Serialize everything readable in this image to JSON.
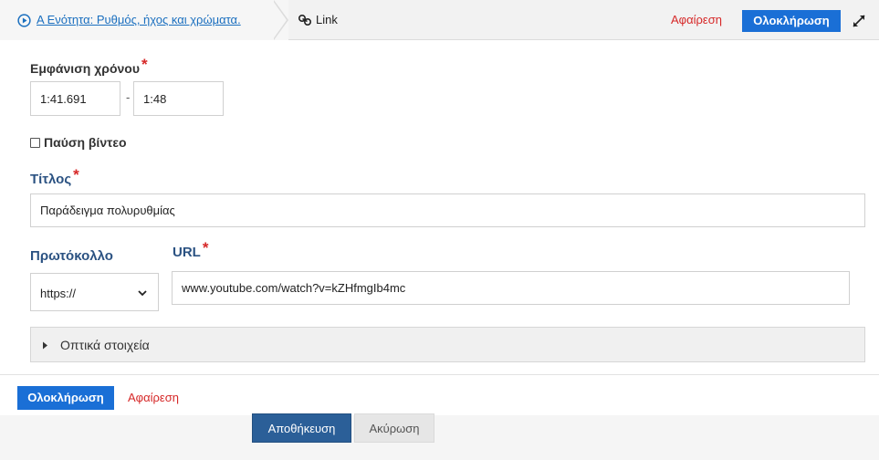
{
  "topbar": {
    "breadcrumb_link": "Α Ενότητα: Ρυθμός, ήχος και χρώματα.",
    "current_label": "Link",
    "remove_label": "Αφαίρεση",
    "done_label": "Ολοκλήρωση",
    "icons": [
      "play-circle-icon",
      "link-icon",
      "expand-icon"
    ]
  },
  "form": {
    "time_label": "Εμφάνιση χρόνου",
    "time_start": "1:41.691",
    "time_separator": "-",
    "time_end": "1:48",
    "pause_label": "Παύση βίντεο",
    "pause_checked": false,
    "title_label": "Τίτλος",
    "title_value": "Παράδειγμα πολυρυθμίας",
    "protocol_label": "Πρωτόκολλο",
    "protocol_value": "https://",
    "url_label": "URL",
    "url_value": "www.youtube.com/watch?v=kZHfmgIb4mc",
    "required_mark": "*",
    "visuals_label": "Οπτικά στοιχεία"
  },
  "footer": {
    "done_label": "Ολοκλήρωση",
    "remove_label": "Αφαίρεση",
    "save_label": "Αποθήκευση",
    "cancel_label": "Ακύρωση"
  },
  "colors": {
    "accent": "#1a6fd6",
    "danger": "#d62828",
    "link": "#1a6fbf",
    "heading_blue": "#2b5282",
    "save": "#2b5f98"
  }
}
